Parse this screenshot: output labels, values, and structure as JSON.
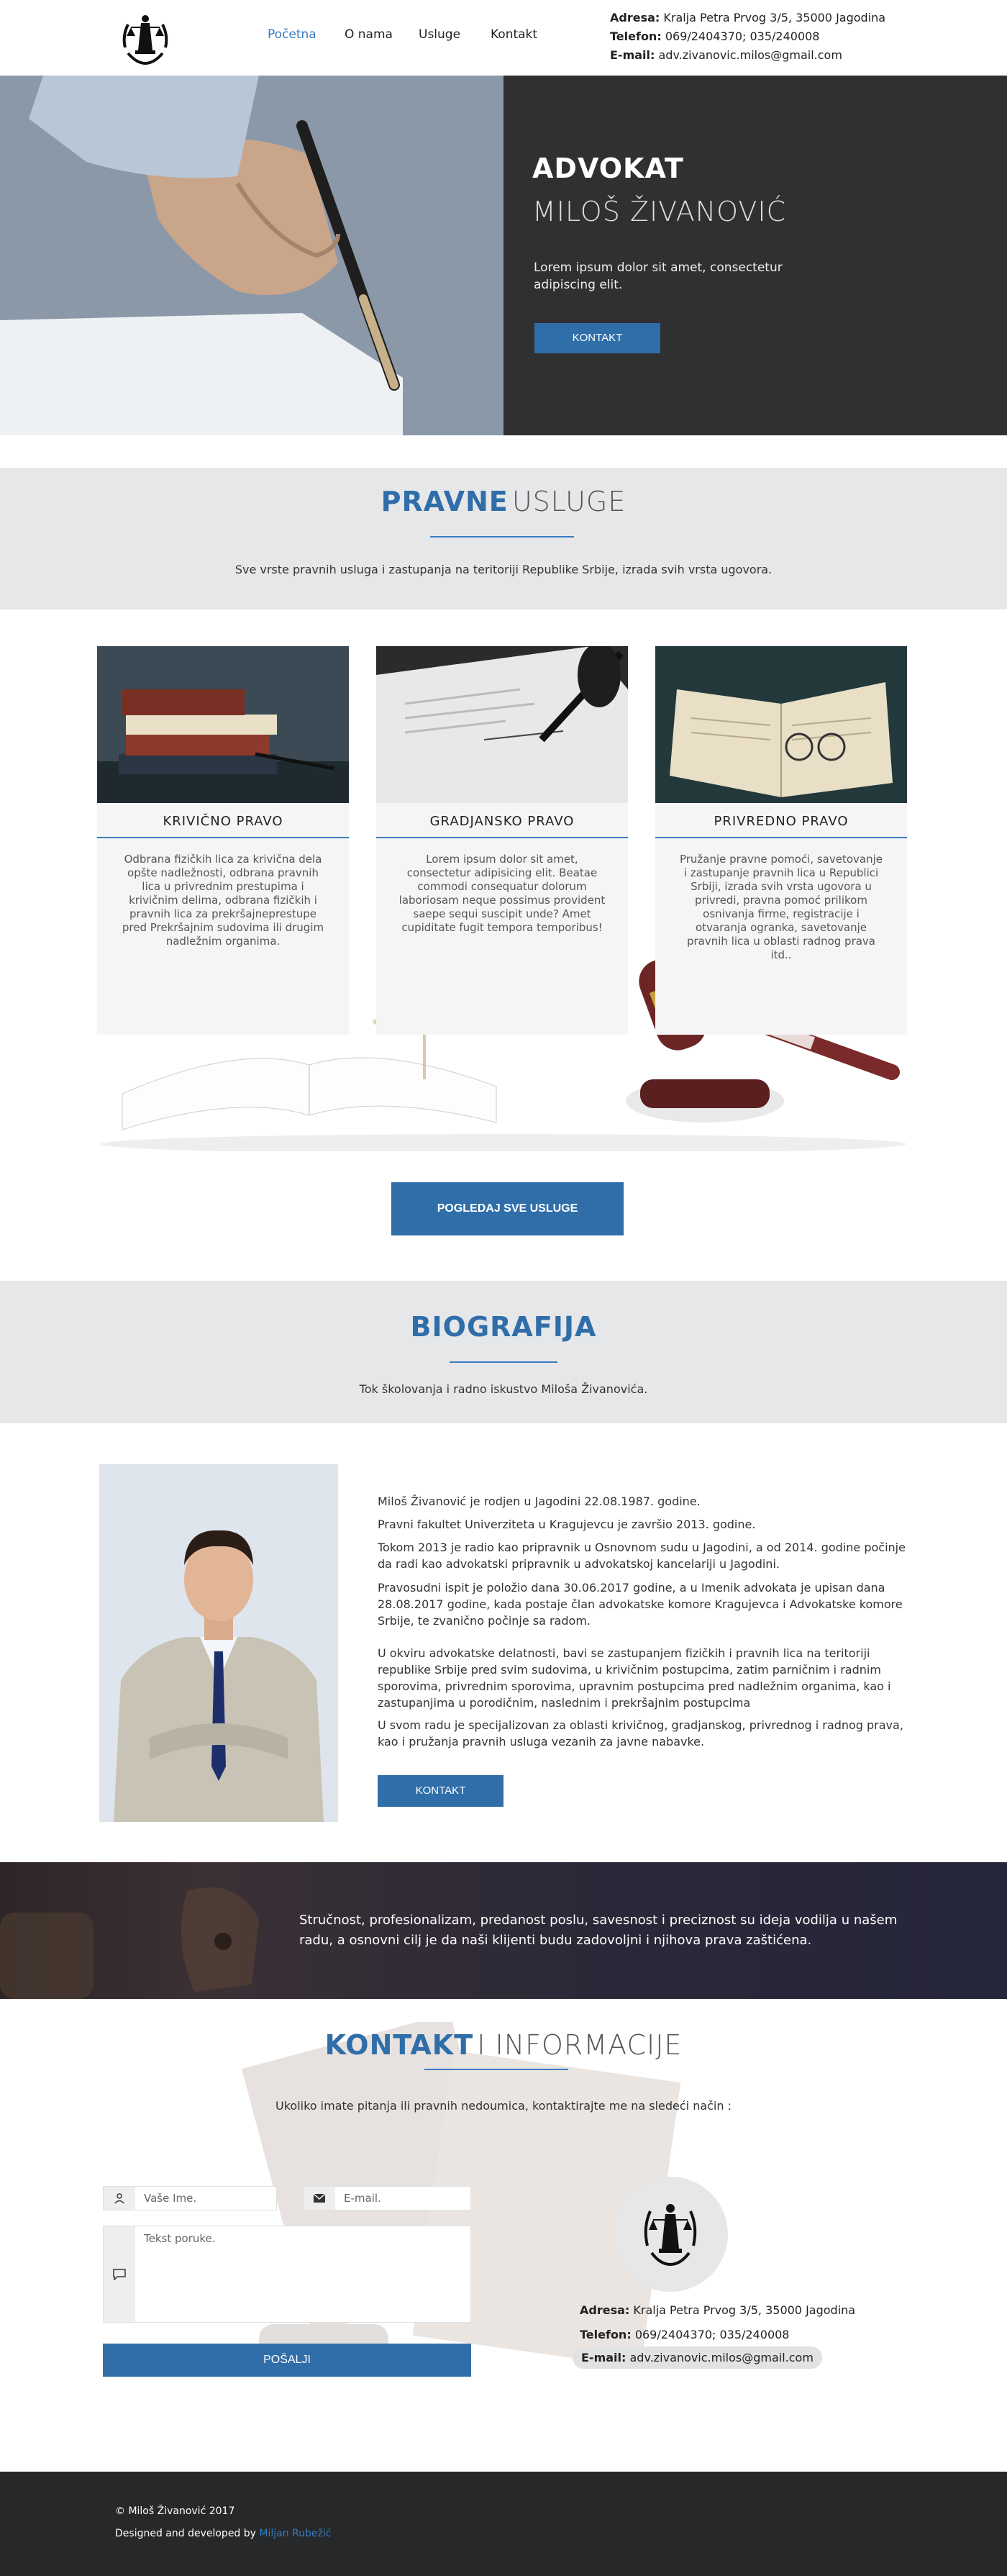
{
  "header": {
    "nav": [
      "Početna",
      "O nama",
      "Usluge",
      "Kontakt"
    ],
    "address_label": "Adresa:",
    "address": "Kralja Petra Prvog 3/5, 35000 Jagodina",
    "phone_label": "Telefon:",
    "phone": "069/2404370; 035/240008",
    "email_label": "E-mail:",
    "email": "adv.zivanovic.milos@gmail.com"
  },
  "hero": {
    "title": "ADVOKAT",
    "name": "MILOŠ ŽIVANOVIĆ",
    "description": "Lorem ipsum dolor sit amet, consectetur adipiscing elit.",
    "button": "KONTAKT"
  },
  "services": {
    "title_strong": "PRAVNE",
    "title_light": "USLUGE",
    "subtitle": "Sve vrste pravnih usluga i zastupanja na teritoriji Republike Srbije, izrada svih vrsta ugovora.",
    "cards": [
      {
        "title": "KRIVIČNO PRAVO",
        "text": "Odbrana fizičkih lica za krivična dela opšte nadležnosti, odbrana pravnih lica u privrednim prestupima i krivičnim delima, odbrana fizičkih i pravnih lica za prekršajneprestupe pred Prekršajnim sudovima ili drugim nadležnim organima."
      },
      {
        "title": "GRADJANSKO PRAVO",
        "text": "Lorem ipsum dolor sit amet, consectetur adipisicing elit. Beatae commodi consequatur dolorum laboriosam neque possimus provident saepe sequi suscipit unde? Amet cupiditate fugit tempora temporibus!"
      },
      {
        "title": "PRIVREDNO PRAVO",
        "text": "Pružanje pravne pomoći, savetovanje i zastupanje pravnih lica u Republici Srbiji, izrada svih vrsta ugovora u privredi, pravna pomoć prilikom osnivanja firme, registracije i otvaranja ogranka, savetovanje pravnih lica u oblasti radnog prava itd.."
      }
    ],
    "all_button": "POGLEDAJ SVE USLUGE"
  },
  "biography": {
    "title": "BIOGRAFIJA",
    "subtitle": "Tok školovanja i radno iskustvo Miloša Živanovića.",
    "paragraphs": [
      "Miloš Živanović je rodjen u Jagodini 22.08.1987. godine.",
      "Pravni fakultet Univerziteta u Kragujevcu je završio 2013. godine.",
      "Tokom 2013 je radio kao pripravnik u Osnovnom sudu u Jagodini, a od 2014. godine počinje da radi kao advokatski pripravnik u advokatskoj kancelariji u Jagodini.",
      "Pravosudni ispit je položio dana 30.06.2017 godine, a u Imenik advokata je upisan dana 28.08.2017 godine, kada postaje član advokatske komore Kragujevca i Advokatske komore Srbije, te zvanično počinje sa radom.",
      "U okviru advokatske delatnosti, bavi se zastupanjem fizičkih i pravnih lica na teritoriji republike Srbije pred svim sudovima, u krivičnim postupcima, zatim parničnim i radnim sporovima, privrednim sporovima, upravnim postupcima pred nadležnim organima, kao i zastupanjima u porodičnim, naslednim i prekršajnim postupcima",
      "U svom radu je specijalizovan za oblasti krivičnog, gradjanskog, privrednog i radnog prava, kao i pružanja pravnih usluga vezanih za javne nabavke."
    ],
    "button": "KONTAKT"
  },
  "quote": "Stručnost, profesionalizam, predanost poslu, savesnost i preciznost su ideja vodilja u našem radu, a osnovni cilj je da naši klijenti budu zadovoljni i njihova prava zaštićena.",
  "contact": {
    "title_strong": "KONTAKT",
    "title_light": "I INFORMACIJE",
    "subtitle": "Ukoliko imate pitanja ili pravnih nedoumica, kontaktirajte me na sledeći način :",
    "name_placeholder": "Vaše Ime.",
    "email_placeholder": "E-mail.",
    "message_placeholder": "Tekst poruke.",
    "send_button": "POŠALJI",
    "address_label": "Adresa:",
    "address": "Kralja Petra Prvog 3/5, 35000 Jagodina",
    "phone_label": "Telefon:",
    "phone": "069/2404370; 035/240008",
    "email_label": "E-mail:",
    "email": "adv.zivanovic.milos@gmail.com"
  },
  "footer": {
    "copyright": "© Miloš Živanović 2017",
    "credit_prefix": "Designed and developed by",
    "credit_name": "Miljan Rubežić"
  },
  "colors": {
    "accent": "#2f6ea9",
    "dark": "#303033",
    "footer": "#262829",
    "grey_band": "#e6e7e9"
  }
}
